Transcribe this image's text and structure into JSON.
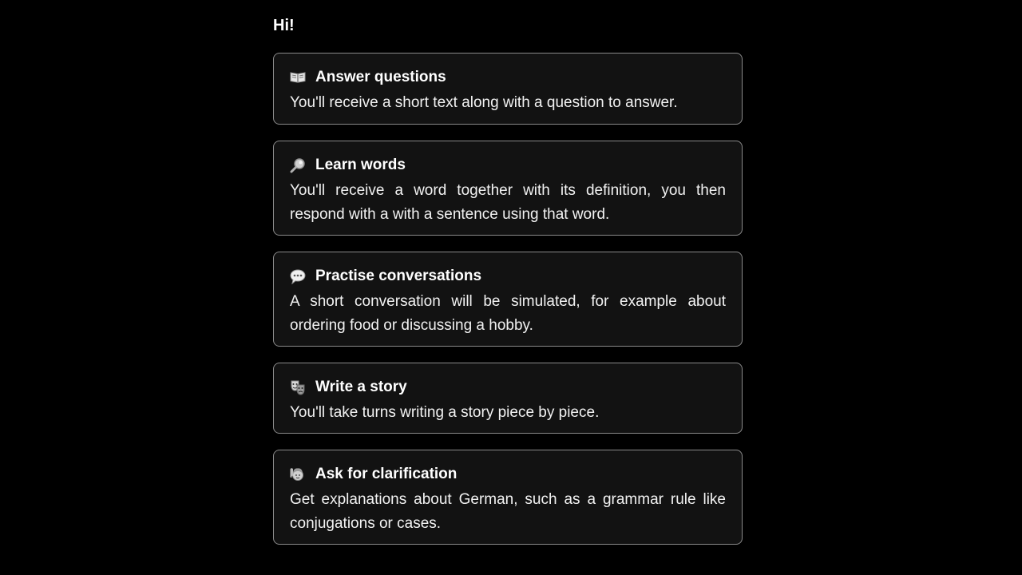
{
  "greeting": "Hi!",
  "cards": [
    {
      "icon": "open-book-icon",
      "title": "Answer questions",
      "description": "You'll receive a short text along with a question to answer."
    },
    {
      "icon": "magnifying-glass-icon",
      "title": "Learn words",
      "description": "You'll receive a word together with its definition, you then respond with a with a sentence using that word."
    },
    {
      "icon": "speech-bubble-icon",
      "title": "Practise conversations",
      "description": "A short conversation will be simulated, for example about ordering food or discussing a hobby."
    },
    {
      "icon": "theater-masks-icon",
      "title": "Write a story",
      "description": "You'll take turns writing a story piece by piece."
    },
    {
      "icon": "raising-hand-icon",
      "title": "Ask for clarification",
      "description": "Get explanations about German, such as a grammar rule like conjugations or cases."
    }
  ]
}
